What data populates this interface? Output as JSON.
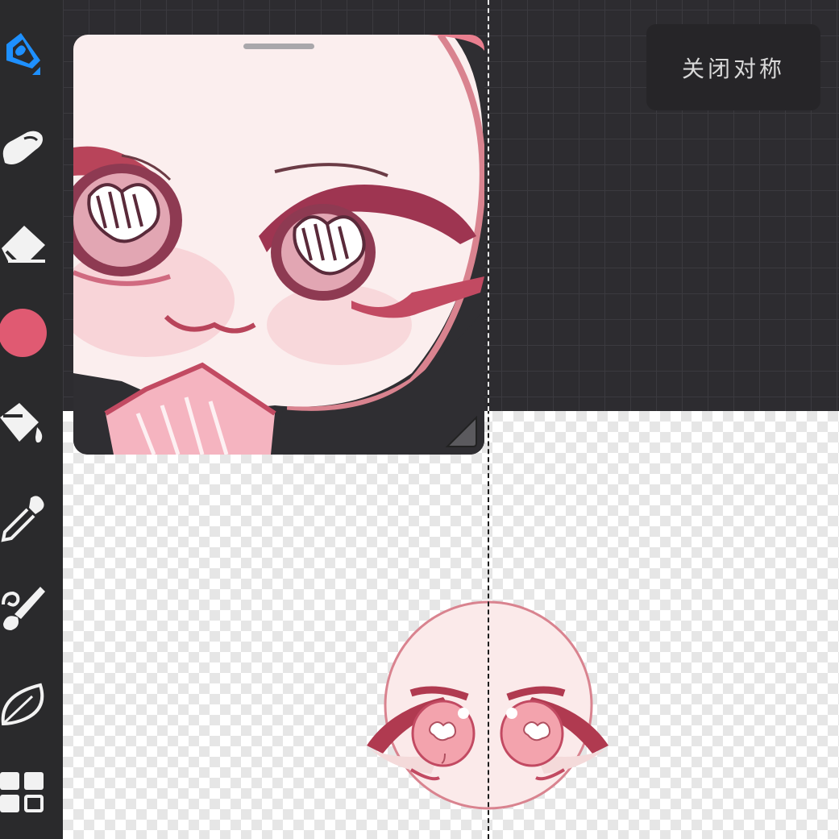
{
  "app": {
    "symmetry_button_label": "关闭对称"
  },
  "toolbar": {
    "tools": [
      {
        "name": "brush-icon",
        "active": true
      },
      {
        "name": "smudge-icon"
      },
      {
        "name": "eraser-icon"
      },
      {
        "name": "color-swatch",
        "color": "#e05a72"
      },
      {
        "name": "fill-bucket-icon"
      },
      {
        "name": "eyedropper-icon"
      },
      {
        "name": "brush-library-icon"
      },
      {
        "name": "leaf-icon"
      },
      {
        "name": "layers-icon"
      }
    ],
    "accent_color": "#1e90ff"
  },
  "colors": {
    "grid_background": "#2d2c30",
    "toolbar_background": "#2a2a2c",
    "current_brush_color": "#e05a72"
  }
}
